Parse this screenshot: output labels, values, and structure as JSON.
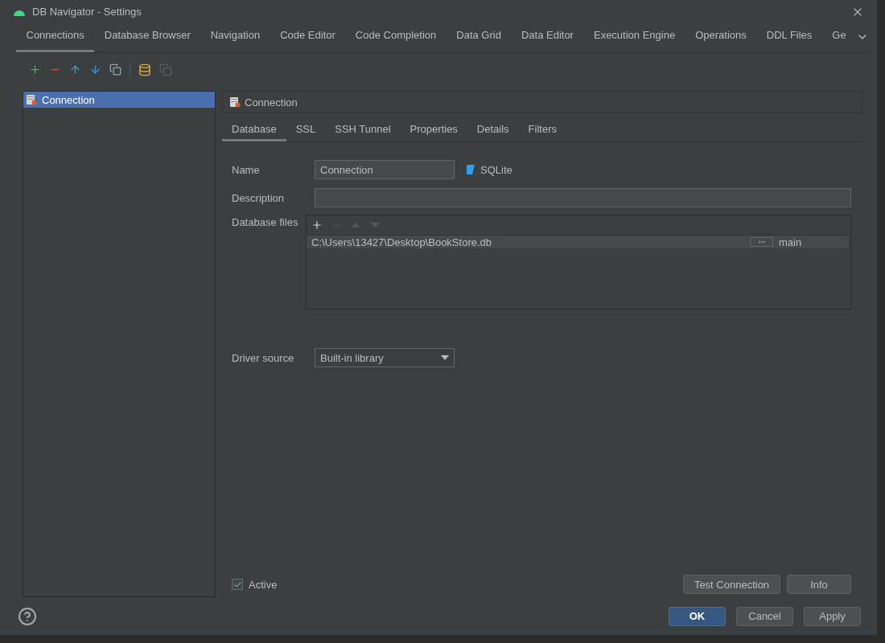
{
  "window": {
    "title": "DB Navigator - Settings"
  },
  "tabs": [
    {
      "label": "Connections",
      "selected": true
    },
    {
      "label": "Database Browser",
      "selected": false
    },
    {
      "label": "Navigation",
      "selected": false
    },
    {
      "label": "Code Editor",
      "selected": false
    },
    {
      "label": "Code Completion",
      "selected": false
    },
    {
      "label": "Data Grid",
      "selected": false
    },
    {
      "label": "Data Editor",
      "selected": false
    },
    {
      "label": "Execution Engine",
      "selected": false
    },
    {
      "label": "Operations",
      "selected": false
    },
    {
      "label": "DDL Files",
      "selected": false
    },
    {
      "label": "Ge",
      "selected": false
    }
  ],
  "connections": [
    {
      "name": "Connection",
      "selected": true
    }
  ],
  "panel": {
    "title": "Connection",
    "tabs": [
      {
        "label": "Database",
        "selected": true
      },
      {
        "label": "SSL",
        "selected": false
      },
      {
        "label": "SSH Tunnel",
        "selected": false
      },
      {
        "label": "Properties",
        "selected": false
      },
      {
        "label": "Details",
        "selected": false
      },
      {
        "label": "Filters",
        "selected": false
      }
    ],
    "name": {
      "label": "Name",
      "value": "Connection"
    },
    "database_type": "SQLite",
    "description": {
      "label": "Description"
    },
    "database_files": {
      "label": "Database files",
      "files": [
        {
          "path": "C:\\Users\\13427\\Desktop\\BookStore.db",
          "schema": "main"
        }
      ]
    },
    "driver_source": {
      "label": "Driver source",
      "value": "Built-in library"
    },
    "active": {
      "label": "Active",
      "checked": true
    },
    "buttons": [
      "Test Connection",
      "Info"
    ]
  },
  "footer_buttons": [
    {
      "label": "OK",
      "kind": "primary"
    },
    {
      "label": "Cancel",
      "kind": "normal"
    },
    {
      "label": "Apply",
      "kind": "normal"
    }
  ]
}
